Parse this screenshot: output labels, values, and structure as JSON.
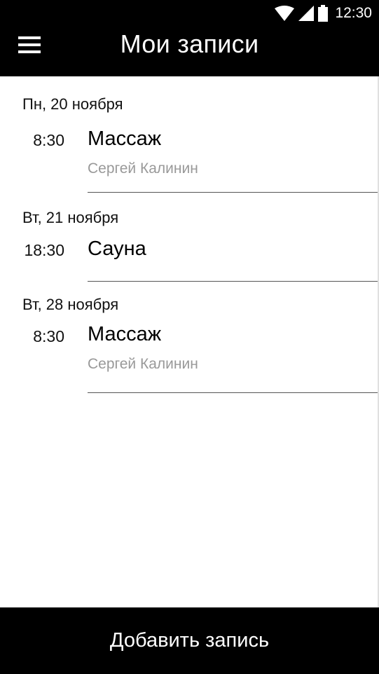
{
  "status_bar": {
    "time": "12:30",
    "icons": [
      "wifi-icon",
      "cellular-signal-icon",
      "battery-icon"
    ]
  },
  "header": {
    "title": "Мои записи",
    "menu_icon": "hamburger-menu-icon"
  },
  "days": [
    {
      "label": "Пн, 20 ноября",
      "appointments": [
        {
          "time": "8:30",
          "service": "Массаж",
          "specialist": "Сергей Калинин"
        }
      ]
    },
    {
      "label": "Вт, 21 ноября",
      "appointments": [
        {
          "time": "18:30",
          "service": "Сауна"
        }
      ]
    },
    {
      "label": "Вт, 28 ноября",
      "appointments": [
        {
          "time": "8:30",
          "service": "Массаж",
          "specialist": "Сергей Калинин"
        }
      ]
    }
  ],
  "footer": {
    "add_label": "Добавить запись"
  },
  "colors": {
    "bar_background": "#000000",
    "bar_text": "#ffffff",
    "secondary_text": "#999999",
    "divider": "#555555"
  }
}
